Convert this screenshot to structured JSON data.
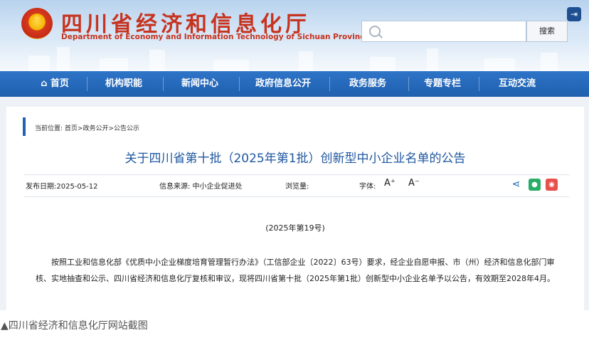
{
  "header": {
    "title_cn": "四川省经济和信息化厅",
    "title_en": "Department of Economy and Information Technology of Sichuan Province",
    "search_placeholder": "",
    "search_button": "搜索"
  },
  "nav": {
    "items": [
      {
        "label": "首页",
        "icon": "home-icon"
      },
      {
        "label": "机构职能"
      },
      {
        "label": "新闻中心"
      },
      {
        "label": "政府信息公开"
      },
      {
        "label": "政务服务"
      },
      {
        "label": "专题专栏"
      },
      {
        "label": "互动交流"
      }
    ]
  },
  "breadcrumb": {
    "prefix": "当前位置:",
    "path": "首页>政务公开>公告公示"
  },
  "article": {
    "title": "关于四川省第十批（2025年第1批）创新型中小企业名单的公告",
    "publish_date": "发布日期:2025-05-12",
    "source": "信息来源:  中小企业促进处",
    "views": "浏览量:",
    "font_label": "字体:",
    "font_larger": "A⁺",
    "font_smaller": "A⁻",
    "issue_no": "(2025年第19号)",
    "body": "按照工业和信息化部《优质中小企业梯度培育管理暂行办法》（工信部企业〔2022〕63号）要求，经企业自愿申报、市（州）经济和信息化部门审核、实地抽查和公示、四川省经济和信息化厅复核和审议，现将四川省第十批（2025年第1批）创新型中小企业名单予以公告，有效期至2028年4月。"
  },
  "share": {
    "share_icon": "share-icon",
    "wechat_icon": "wechat-icon",
    "weibo_icon": "weibo-icon",
    "colors": {
      "wechat": "#2aae67",
      "weibo": "#e8504b",
      "share": "#1f63b5"
    }
  },
  "caption": "▲四川省经济和信息化厅网站截图",
  "colors": {
    "nav": "#2569bd",
    "brand_red": "#c7331f",
    "title_blue": "#1f57a0"
  }
}
